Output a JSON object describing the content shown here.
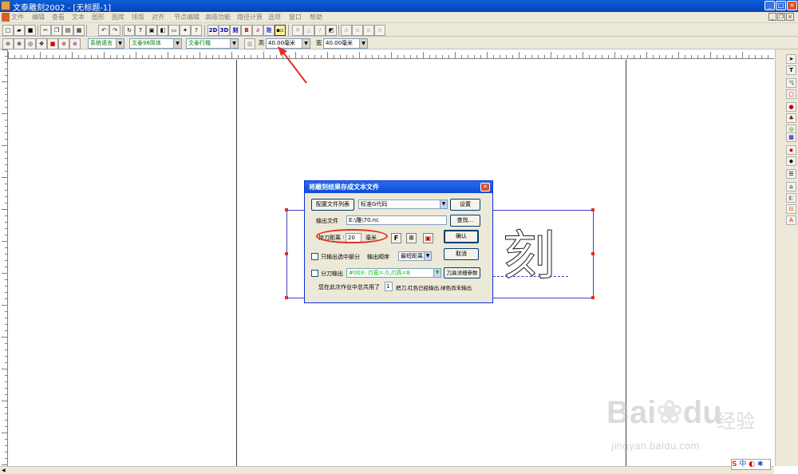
{
  "window": {
    "title": "文泰雕刻2002 - [无标题-1]"
  },
  "menu": [
    "文件",
    "编辑",
    "查看",
    "文本",
    "图形",
    "图库",
    "排版",
    "对齐",
    "节点编辑",
    "高级功能",
    "路径计算",
    "选项",
    "窗口",
    "帮助"
  ],
  "toolbar1": {
    "btn_2d": "2D",
    "btn_3d": "3D",
    "btn_carve": "刻",
    "btn_b": "B"
  },
  "toolbar2": {
    "language": "系统语言",
    "font": "文泰98简体",
    "style": "文泰行楷",
    "height_label": "高",
    "height_value": "40.00毫米",
    "width_label": "宽",
    "width_value": "40.00毫米"
  },
  "canvas": {
    "glyph": "刻"
  },
  "dialog": {
    "title": "将雕刻结果存成文本文件",
    "config_button": "配置文件列表",
    "config_value": "标准G代码",
    "settings_button": "设置",
    "output_label": "输出文件",
    "output_path": "E:\\雕\\70.nc",
    "browse_button": "查找...",
    "lift_label": "抬刀距离",
    "lift_value": "20",
    "unit": "毫米",
    "ok_button": "确认",
    "cancel_button": "取消",
    "only_selected_label": "只输出选中部分",
    "order_label": "输出顺序",
    "order_value": "最短距离",
    "split_label": "分刀输出",
    "tool_value": "#003: 刃宽=.0,刃高=8",
    "tool_params_button": "刀具详细参数",
    "summary_prefix": "您在此次作业中总共用了",
    "summary_count": "1",
    "summary_suffix": "把刀,红色已经输出,绿色尚未输出"
  },
  "watermark": {
    "brand": "Bai",
    "brand2": "du",
    "sub": "经验",
    "url": "jingyan.baidu.com"
  },
  "ime": {
    "label": "中"
  },
  "colors": {
    "titlebar": "#0842b8",
    "menubar": "#ece9d8",
    "highlight": "#e03020",
    "tool_green": "#00c000"
  }
}
